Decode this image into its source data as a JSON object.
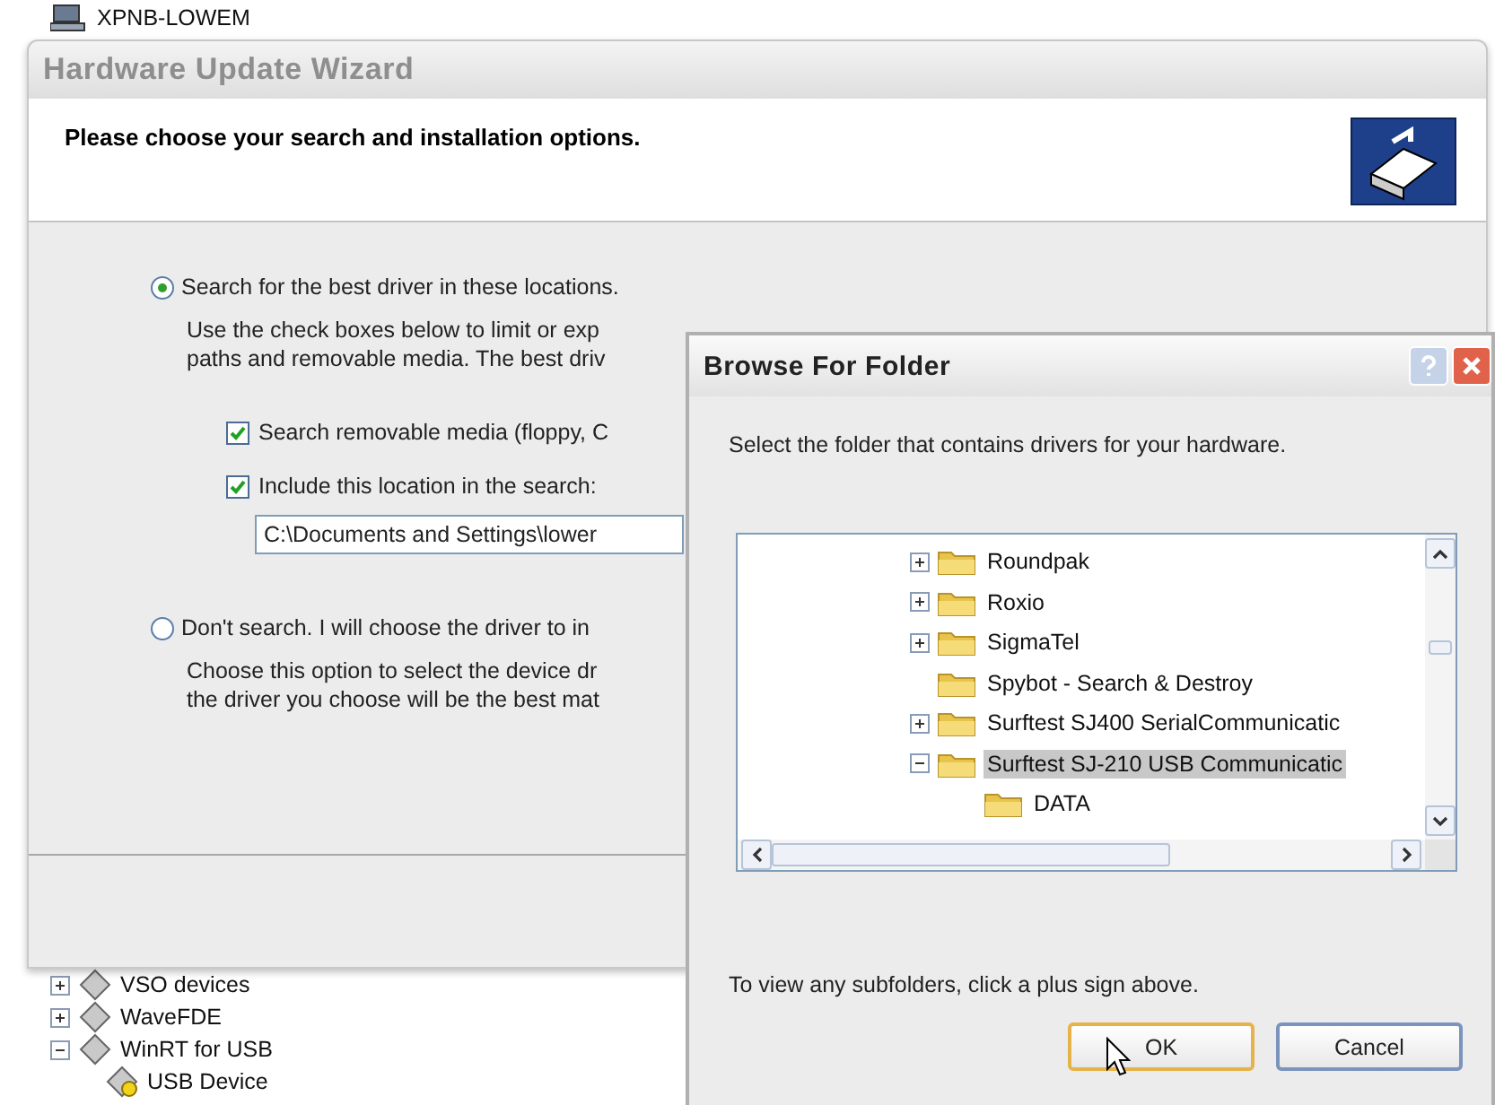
{
  "background_tree": {
    "computer_name": "XPNB-LOWEM",
    "items": [
      {
        "label": "VSO devices",
        "expanded": false
      },
      {
        "label": "WaveFDE",
        "expanded": false
      },
      {
        "label": "WinRT for USB",
        "expanded": true,
        "children": [
          {
            "label": "USB Device",
            "warning": true
          }
        ]
      }
    ]
  },
  "wizard": {
    "title": "Hardware Update Wizard",
    "heading": "Please choose your search and installation options.",
    "options": [
      {
        "label": "Search for the best driver in these locations.",
        "selected": true,
        "description_lines": [
          "Use the check boxes below to limit or exp",
          "paths and removable media. The best driv"
        ],
        "checkboxes": [
          {
            "label": "Search removable media (floppy, C",
            "checked": true
          },
          {
            "label": "Include this location in the search:",
            "checked": true
          }
        ],
        "path_value": "C:\\Documents and Settings\\lower"
      },
      {
        "label": "Don't search. I will choose the driver to in",
        "selected": false,
        "description_lines": [
          "Choose this option to select the device dr",
          "the driver you choose will be the best mat"
        ]
      }
    ]
  },
  "browse_dialog": {
    "title": "Browse For Folder",
    "prompt": "Select the folder that contains drivers for your hardware.",
    "folders": [
      {
        "label": "Roundpak",
        "expanded": false,
        "selected": false
      },
      {
        "label": "Roxio",
        "expanded": false,
        "selected": false
      },
      {
        "label": "SigmaTel",
        "expanded": false,
        "selected": false
      },
      {
        "label": "Spybot - Search & Destroy",
        "selected": false
      },
      {
        "label": "Surftest SJ400 SerialCommunicatic",
        "expanded": false,
        "selected": false
      },
      {
        "label": "Surftest SJ-210 USB Communicatic",
        "expanded": true,
        "selected": true,
        "children": [
          {
            "label": "DATA",
            "selected": false
          }
        ]
      }
    ],
    "hint": "To view any subfolders, click a plus sign above.",
    "buttons": [
      {
        "label": "OK",
        "default": true
      },
      {
        "label": "Cancel",
        "default": false
      }
    ]
  }
}
